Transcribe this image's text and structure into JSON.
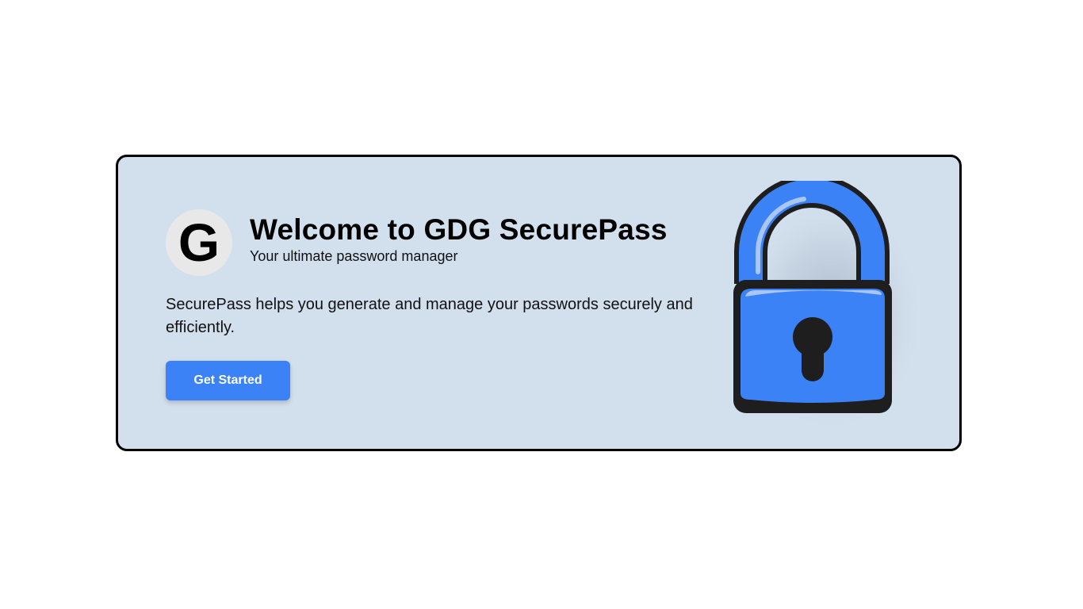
{
  "hero": {
    "logo_letter": "G",
    "title": "Welcome to GDG SecurePass",
    "subtitle": "Your ultimate password manager",
    "description": "SecurePass helps you generate and manage your passwords securely and efficiently.",
    "cta_label": "Get Started"
  },
  "icons": {
    "logo": "google-g-logo-icon",
    "illustration": "padlock-icon"
  },
  "colors": {
    "page_background": "#ffffff",
    "card_background": "#d2dfed",
    "card_border": "#000000",
    "accent": "#3b82f6",
    "lock_body": "#3b82f6",
    "lock_outline": "#1e1e1e"
  }
}
